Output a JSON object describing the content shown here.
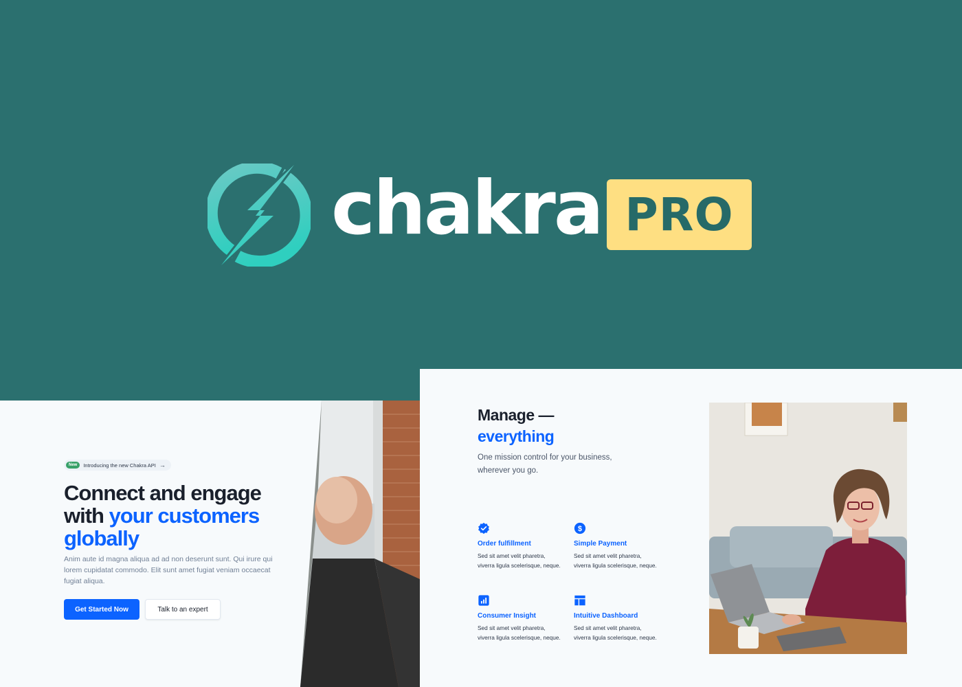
{
  "logo": {
    "wordmark": "chakra",
    "badge": "PRO",
    "colors": {
      "background": "#2b706f",
      "badge": "#fedf82",
      "mark": "#4fd1c5"
    }
  },
  "left_card": {
    "announcement": {
      "tag": "New",
      "text": "Introducing the new Chakra API",
      "arrow": "→"
    },
    "title_line1": "Connect and engage with",
    "title_accent": "your customers globally",
    "description": "Anim aute id magna aliqua ad ad non deserunt sunt. Qui irure qui lorem cupidatat commodo. Elit sunt amet fugiat veniam occaecat fugiat aliqua.",
    "primary_button": "Get Started Now",
    "secondary_button": "Talk to an expert",
    "accent_color": "#0c63ff"
  },
  "right_card": {
    "title": "Manage —",
    "title_accent": "everything",
    "description": "One mission control for your business, wherever you go.",
    "features": [
      {
        "icon": "check-badge-icon",
        "name": "Order fulfillment",
        "text": "Sed sit amet velit pharetra, viverra ligula scelerisque, neque."
      },
      {
        "icon": "dollar-icon",
        "name": "Simple Payment",
        "text": "Sed sit amet velit pharetra, viverra ligula scelerisque, neque."
      },
      {
        "icon": "bar-chart-icon",
        "name": "Consumer Insight",
        "text": "Sed sit amet velit pharetra, viverra ligula scelerisque, neque."
      },
      {
        "icon": "dashboard-icon",
        "name": "Intuitive Dashboard",
        "text": "Sed sit amet velit pharetra, viverra ligula scelerisque, neque."
      }
    ]
  }
}
